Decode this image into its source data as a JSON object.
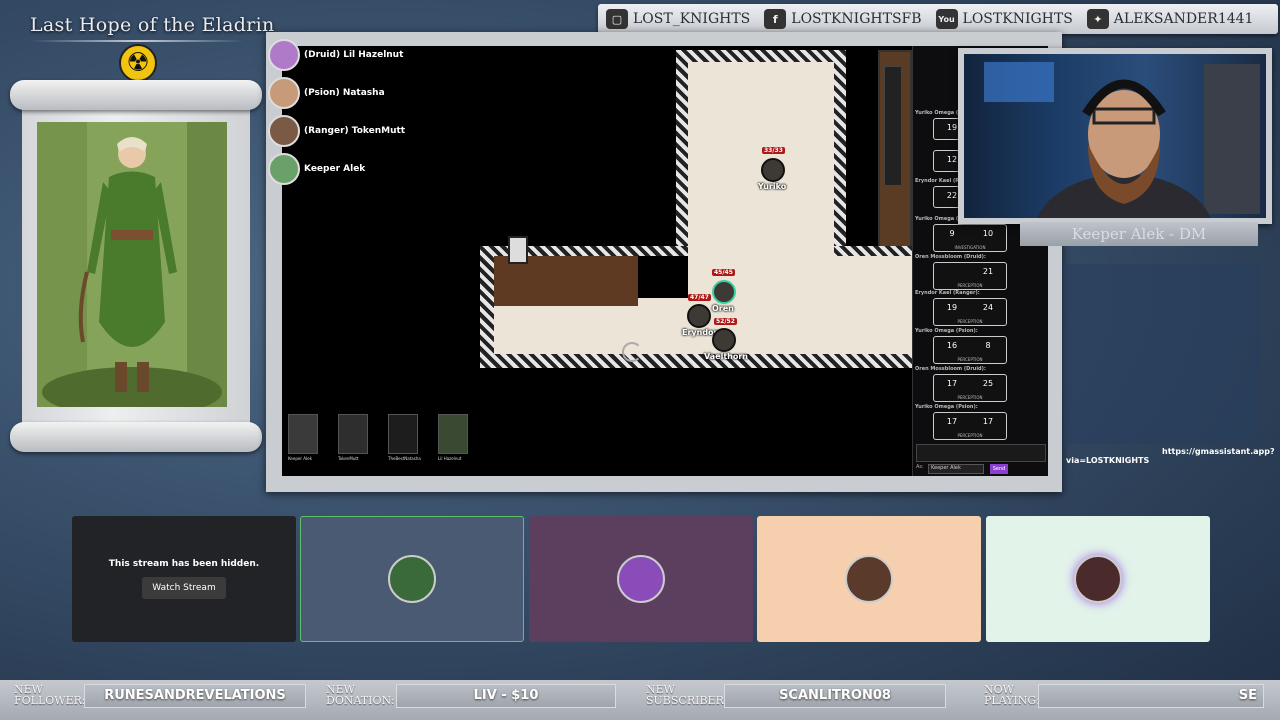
{
  "campaign": {
    "title": "Last Hope of the Eladrin",
    "emblem": "radiation-icon"
  },
  "social": [
    {
      "icon": "twitch-icon",
      "glyph": "▢",
      "handle": "LOST_KNIGHTS"
    },
    {
      "icon": "facebook-icon",
      "glyph": "f",
      "handle": "LOSTKNIGHTSFB"
    },
    {
      "icon": "youtube-icon",
      "glyph": "You",
      "handle": "LOSTKNIGHTS"
    },
    {
      "icon": "twitter-icon",
      "glyph": "✦",
      "handle": "ALEKSANDER1441"
    }
  ],
  "players": [
    {
      "label": "(Druid) Lil Hazelnut",
      "color": "#b07acb"
    },
    {
      "label": "(Psion) Natasha",
      "color": "#c79a7a"
    },
    {
      "label": "(Ranger) TokenMutt",
      "color": "#7a5a45"
    },
    {
      "label": "Keeper Alek",
      "color": "#6aa06a"
    }
  ],
  "tokens": {
    "yuriko": {
      "name": "Yuriko",
      "hp": "33/33"
    },
    "oren": {
      "name": "Oren",
      "hp": "45/45"
    },
    "eryndor": {
      "name": "Eryndor",
      "hp": "47/47"
    },
    "vaelthorn": {
      "name": "Vaelthorn",
      "hp": "52/52"
    }
  },
  "player_thumbs": [
    {
      "label": "Keeper Alek",
      "color": "#2a63d6"
    },
    {
      "label": "TokenMutt",
      "color": "#3a7ad6"
    },
    {
      "label": "TheBestNatasha",
      "color": "#f2b01e"
    },
    {
      "label": "Lil Hazelnut",
      "color": "#8a2be2"
    }
  ],
  "rolls": [
    {
      "who": "Yuriko Omega (Psion):",
      "a": "19",
      "b": "",
      "cap": ""
    },
    {
      "who": "",
      "a": "12",
      "b": "",
      "cap": ""
    },
    {
      "who": "Eryndor Kael (Ranger):",
      "a": "22",
      "b": "",
      "cap": ""
    },
    {
      "who": "Yuriko Omega (Psion):",
      "a": "9",
      "b": "10",
      "cap": "INVESTIGATION"
    },
    {
      "who": "Oren Mossbloom (Druid):",
      "a": "",
      "b": "21",
      "cap": "PERCEPTION"
    },
    {
      "who": "Eryndor Kael (Ranger):",
      "a": "19",
      "b": "24",
      "cap": "PERCEPTION"
    },
    {
      "who": "Yuriko Omega (Psion):",
      "a": "16",
      "b": "8",
      "cap": "PERCEPTION"
    },
    {
      "who": "Oren Mossbloom (Druid):",
      "a": "17",
      "b": "25",
      "cap": "PERCEPTION"
    },
    {
      "who": "Yuriko Omega (Psion):",
      "a": "17",
      "b": "17",
      "cap": "PERCEPTION"
    }
  ],
  "chat": {
    "as_label": "As:",
    "as_value": "Keeper Alek",
    "send": "Send"
  },
  "dm": {
    "plate": "Keeper Alek - DM"
  },
  "overlay": {
    "url": "https://gmassistant.app?",
    "via": "via=LOSTKNIGHTS"
  },
  "tiles": {
    "hidden_message": "This stream has been hidden.",
    "watch_button": "Watch Stream",
    "colors": [
      "#222326",
      "#4a5a72",
      "#5c3f5e",
      "#f6cfae",
      "#e2f3ea"
    ],
    "active_border": "#5ec26a"
  },
  "ticker": {
    "new_follower_label": "NEW FOLLOWER:",
    "new_follower": "RUNESANDREVELATIONS",
    "new_donation_label": "NEW DONATION:",
    "new_donation": "LIV - $10",
    "new_subscriber_label": "NEW SUBSCRIBER:",
    "new_subscriber": "SCANLITRON08",
    "now_playing_label": "NOW PLAYING:",
    "now_playing": "SE"
  }
}
